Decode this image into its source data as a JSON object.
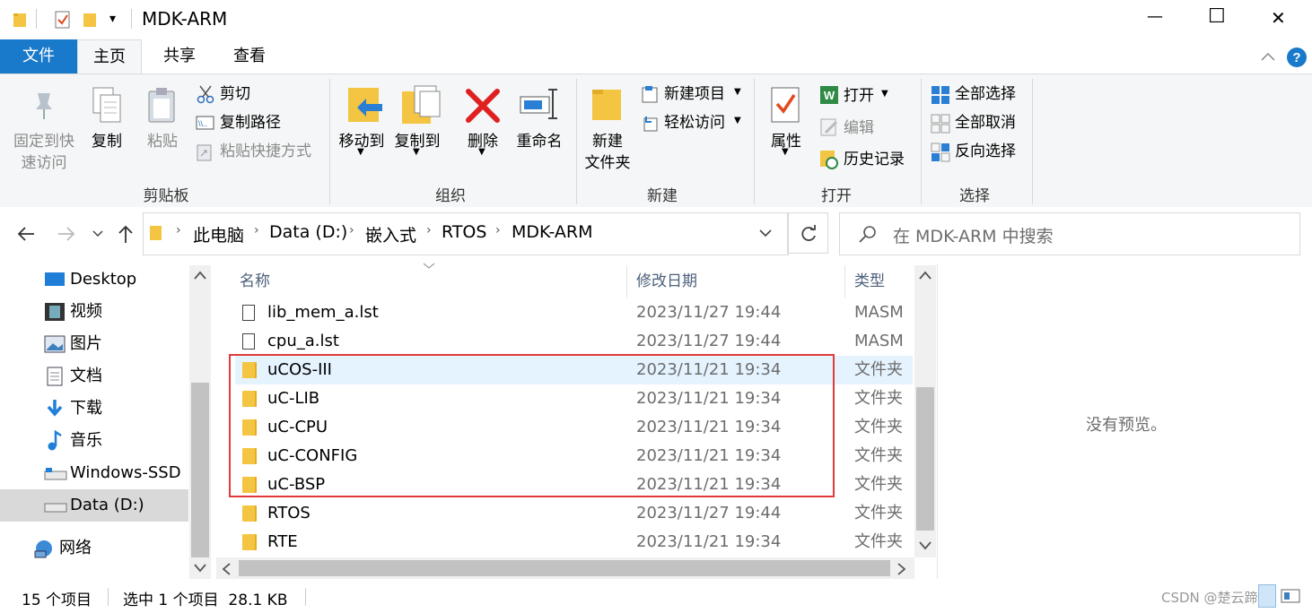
{
  "window": {
    "title": "MDK-ARM",
    "qat_dropdown": "▾",
    "controls": {
      "minimize": "—",
      "maximize": "☐",
      "close": "✕"
    }
  },
  "tabs": [
    {
      "label": "文件",
      "active": false,
      "file": true
    },
    {
      "label": "主页",
      "active": true
    },
    {
      "label": "共享",
      "active": false
    },
    {
      "label": "查看",
      "active": false
    }
  ],
  "ribbon": {
    "clipboard": {
      "label": "剪贴板",
      "pin": "固定到快\n速访问",
      "pin_line1": "固定到快",
      "pin_line2": "速访问",
      "copy": "复制",
      "paste": "粘贴",
      "cut": "剪切",
      "copy_path": "复制路径",
      "paste_shortcut": "粘贴快捷方式"
    },
    "organize": {
      "label": "组织",
      "move_to": "移动到",
      "copy_to": "复制到",
      "delete": "删除",
      "rename": "重命名"
    },
    "new": {
      "label": "新建",
      "new_folder_line1": "新建",
      "new_folder_line2": "文件夹",
      "new_item": "新建项目",
      "easy_access": "轻松访问"
    },
    "open": {
      "label": "打开",
      "properties": "属性",
      "open": "打开",
      "edit": "编辑",
      "history": "历史记录"
    },
    "select": {
      "label": "选择",
      "select_all": "全部选择",
      "select_none": "全部取消",
      "invert": "反向选择"
    }
  },
  "address": {
    "crumbs": [
      "此电脑",
      "Data (D:)",
      "嵌入式",
      "RTOS",
      "MDK-ARM"
    ],
    "search_placeholder": "在 MDK-ARM 中搜索"
  },
  "nav_pane": [
    {
      "label": "Desktop",
      "icon": "desktop-icon"
    },
    {
      "label": "视频",
      "icon": "video-icon"
    },
    {
      "label": "图片",
      "icon": "pictures-icon"
    },
    {
      "label": "文档",
      "icon": "documents-icon"
    },
    {
      "label": "下载",
      "icon": "download-icon"
    },
    {
      "label": "音乐",
      "icon": "music-icon"
    },
    {
      "label": "Windows-SSD (",
      "icon": "drive-icon"
    },
    {
      "label": "Data (D:)",
      "icon": "drive-icon",
      "selected": true
    },
    {
      "label": "网络",
      "icon": "network-icon"
    }
  ],
  "columns": {
    "name": "名称",
    "date": "修改日期",
    "type": "类型"
  },
  "files": [
    {
      "name": "lib_mem_a.lst",
      "date": "2023/11/27 19:44",
      "type": "MASM",
      "kind": "file"
    },
    {
      "name": "cpu_a.lst",
      "date": "2023/11/27 19:44",
      "type": "MASM",
      "kind": "file"
    },
    {
      "name": "uCOS-III",
      "date": "2023/11/21 19:34",
      "type": "文件夹",
      "kind": "folder",
      "hover": true
    },
    {
      "name": "uC-LIB",
      "date": "2023/11/21 19:34",
      "type": "文件夹",
      "kind": "folder"
    },
    {
      "name": "uC-CPU",
      "date": "2023/11/21 19:34",
      "type": "文件夹",
      "kind": "folder"
    },
    {
      "name": "uC-CONFIG",
      "date": "2023/11/21 19:34",
      "type": "文件夹",
      "kind": "folder"
    },
    {
      "name": "uC-BSP",
      "date": "2023/11/21 19:34",
      "type": "文件夹",
      "kind": "folder"
    },
    {
      "name": "RTOS",
      "date": "2023/11/27 19:44",
      "type": "文件夹",
      "kind": "folder"
    },
    {
      "name": "RTE",
      "date": "2023/11/21 19:34",
      "type": "文件夹",
      "kind": "folder"
    }
  ],
  "preview": {
    "text": "没有预览。"
  },
  "status": {
    "count": "15 个项目",
    "selection": "选中 1 个项目  28.1 KB"
  },
  "watermark": "CSDN @楚云蹄1",
  "colors": {
    "accent": "#1979ca",
    "highlight_box": "#e03a3a",
    "hover": "#e5f3ff"
  }
}
